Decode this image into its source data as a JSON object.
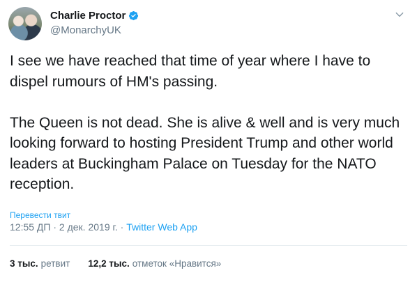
{
  "author": {
    "name": "Charlie Proctor",
    "handle": "@MonarchyUK",
    "verified": true
  },
  "tweet": {
    "text": "I see we have reached that time of year where I have to dispel rumours of HM's passing.\n\nThe Queen is not dead. She is alive & well and is very much looking forward to hosting President Trump and other world leaders at Buckingham Palace on Tuesday for the NATO reception.",
    "translate_label": "Перевести твит",
    "time": "12:55 ДП",
    "separator": " · ",
    "date": "2 дек. 2019 г.",
    "app": "Twitter Web App"
  },
  "stats": {
    "retweets_count": "3 тыс.",
    "retweets_label": "ретвит",
    "likes_count": "12,2 тыс.",
    "likes_label": "отметок «Нравится»"
  },
  "colors": {
    "accent": "#1da1f2",
    "text": "#14171a",
    "muted": "#657786",
    "divider": "#e6ecf0"
  },
  "icons": [
    "verified-badge-icon",
    "chevron-down-icon"
  ]
}
